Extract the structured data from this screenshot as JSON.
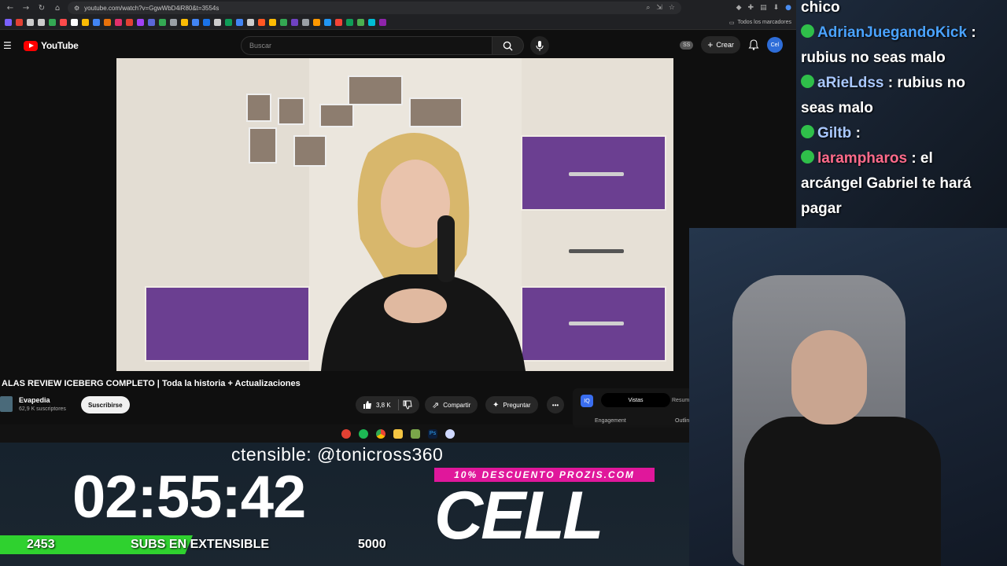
{
  "browser": {
    "url": "youtube.com/watch?v=GgwWbD4iR80&t=3554s",
    "bookmarks_all": "Todos los marcadores",
    "bookmark_colors": [
      "#7b61ff",
      "#e34133",
      "#cccccc",
      "#cccccc",
      "#34a853",
      "#ff4b4b",
      "#ffffff",
      "#fbbc04",
      "#4285f4",
      "#e8710a",
      "#e1306c",
      "#e34133",
      "#a142f4",
      "#5a67d8",
      "#34a853",
      "#9aa0a6",
      "#fbbc04",
      "#4285f4",
      "#1a73e8",
      "#cccccc",
      "#0f9d58",
      "#4285f4",
      "#cccccc",
      "#ff5722",
      "#fbbc04",
      "#34a853",
      "#6f42c1",
      "#9aa0a6",
      "#ff9800",
      "#2196f3",
      "#f44336",
      "#0f9d58",
      "#4caf50",
      "#00bcd4",
      "#8e24aa"
    ]
  },
  "youtube": {
    "logo": "YouTube",
    "search_placeholder": "Buscar",
    "ss_badge": "SS",
    "create_label": "Crear",
    "avatar_label": "Cel",
    "video_title": "ALAS REVIEW ICEBERG COMPLETO | Toda la historia + Actualizaciones",
    "channel_name": "Evapedia",
    "channel_subs": "62,9 K suscriptores",
    "subscribe_label": "Suscribirse",
    "likes": "3,8 K",
    "share_label": "Compartir",
    "ask_label": "Preguntar",
    "panel_tab_active": "Vistas",
    "panel_tab_2": "Resum",
    "panel_label_1": "Engagement",
    "panel_label_2": "Outlin"
  },
  "chat": {
    "messages": [
      {
        "user": "",
        "text": "chico",
        "user_color": "#ffffff"
      },
      {
        "user": "AdrianJuegandoKick",
        "text": ":",
        "user_color": "#4aa3ff"
      },
      {
        "user": "",
        "text": "rubius no seas malo",
        "user_color": "#ffffff"
      },
      {
        "user": "aRieLdss",
        "text": ": rubius no",
        "user_color": "#a9c8ff"
      },
      {
        "user": "",
        "text": "seas malo",
        "user_color": "#ffffff"
      },
      {
        "user": "Giltb",
        "text": ":",
        "user_color": "#a9c8ff"
      },
      {
        "user": "larampharos",
        "text": ": el",
        "user_color": "#ff6b8b"
      },
      {
        "user": "",
        "text": "arcángel Gabriel te hará",
        "user_color": "#ffffff"
      },
      {
        "user": "",
        "text": "pagar",
        "user_color": "#ffffff"
      }
    ]
  },
  "overlay": {
    "ticker": "ctensible: @tonicross360",
    "timer": "02:55:42",
    "subs_current": "2453",
    "subs_label": "SUBS EN EXTENSIBLE",
    "subs_goal": "5000",
    "subs_progress_fraction": 0.49,
    "promo": "10% DESCUENTO PROZIS.COM",
    "brand": "CELL"
  }
}
